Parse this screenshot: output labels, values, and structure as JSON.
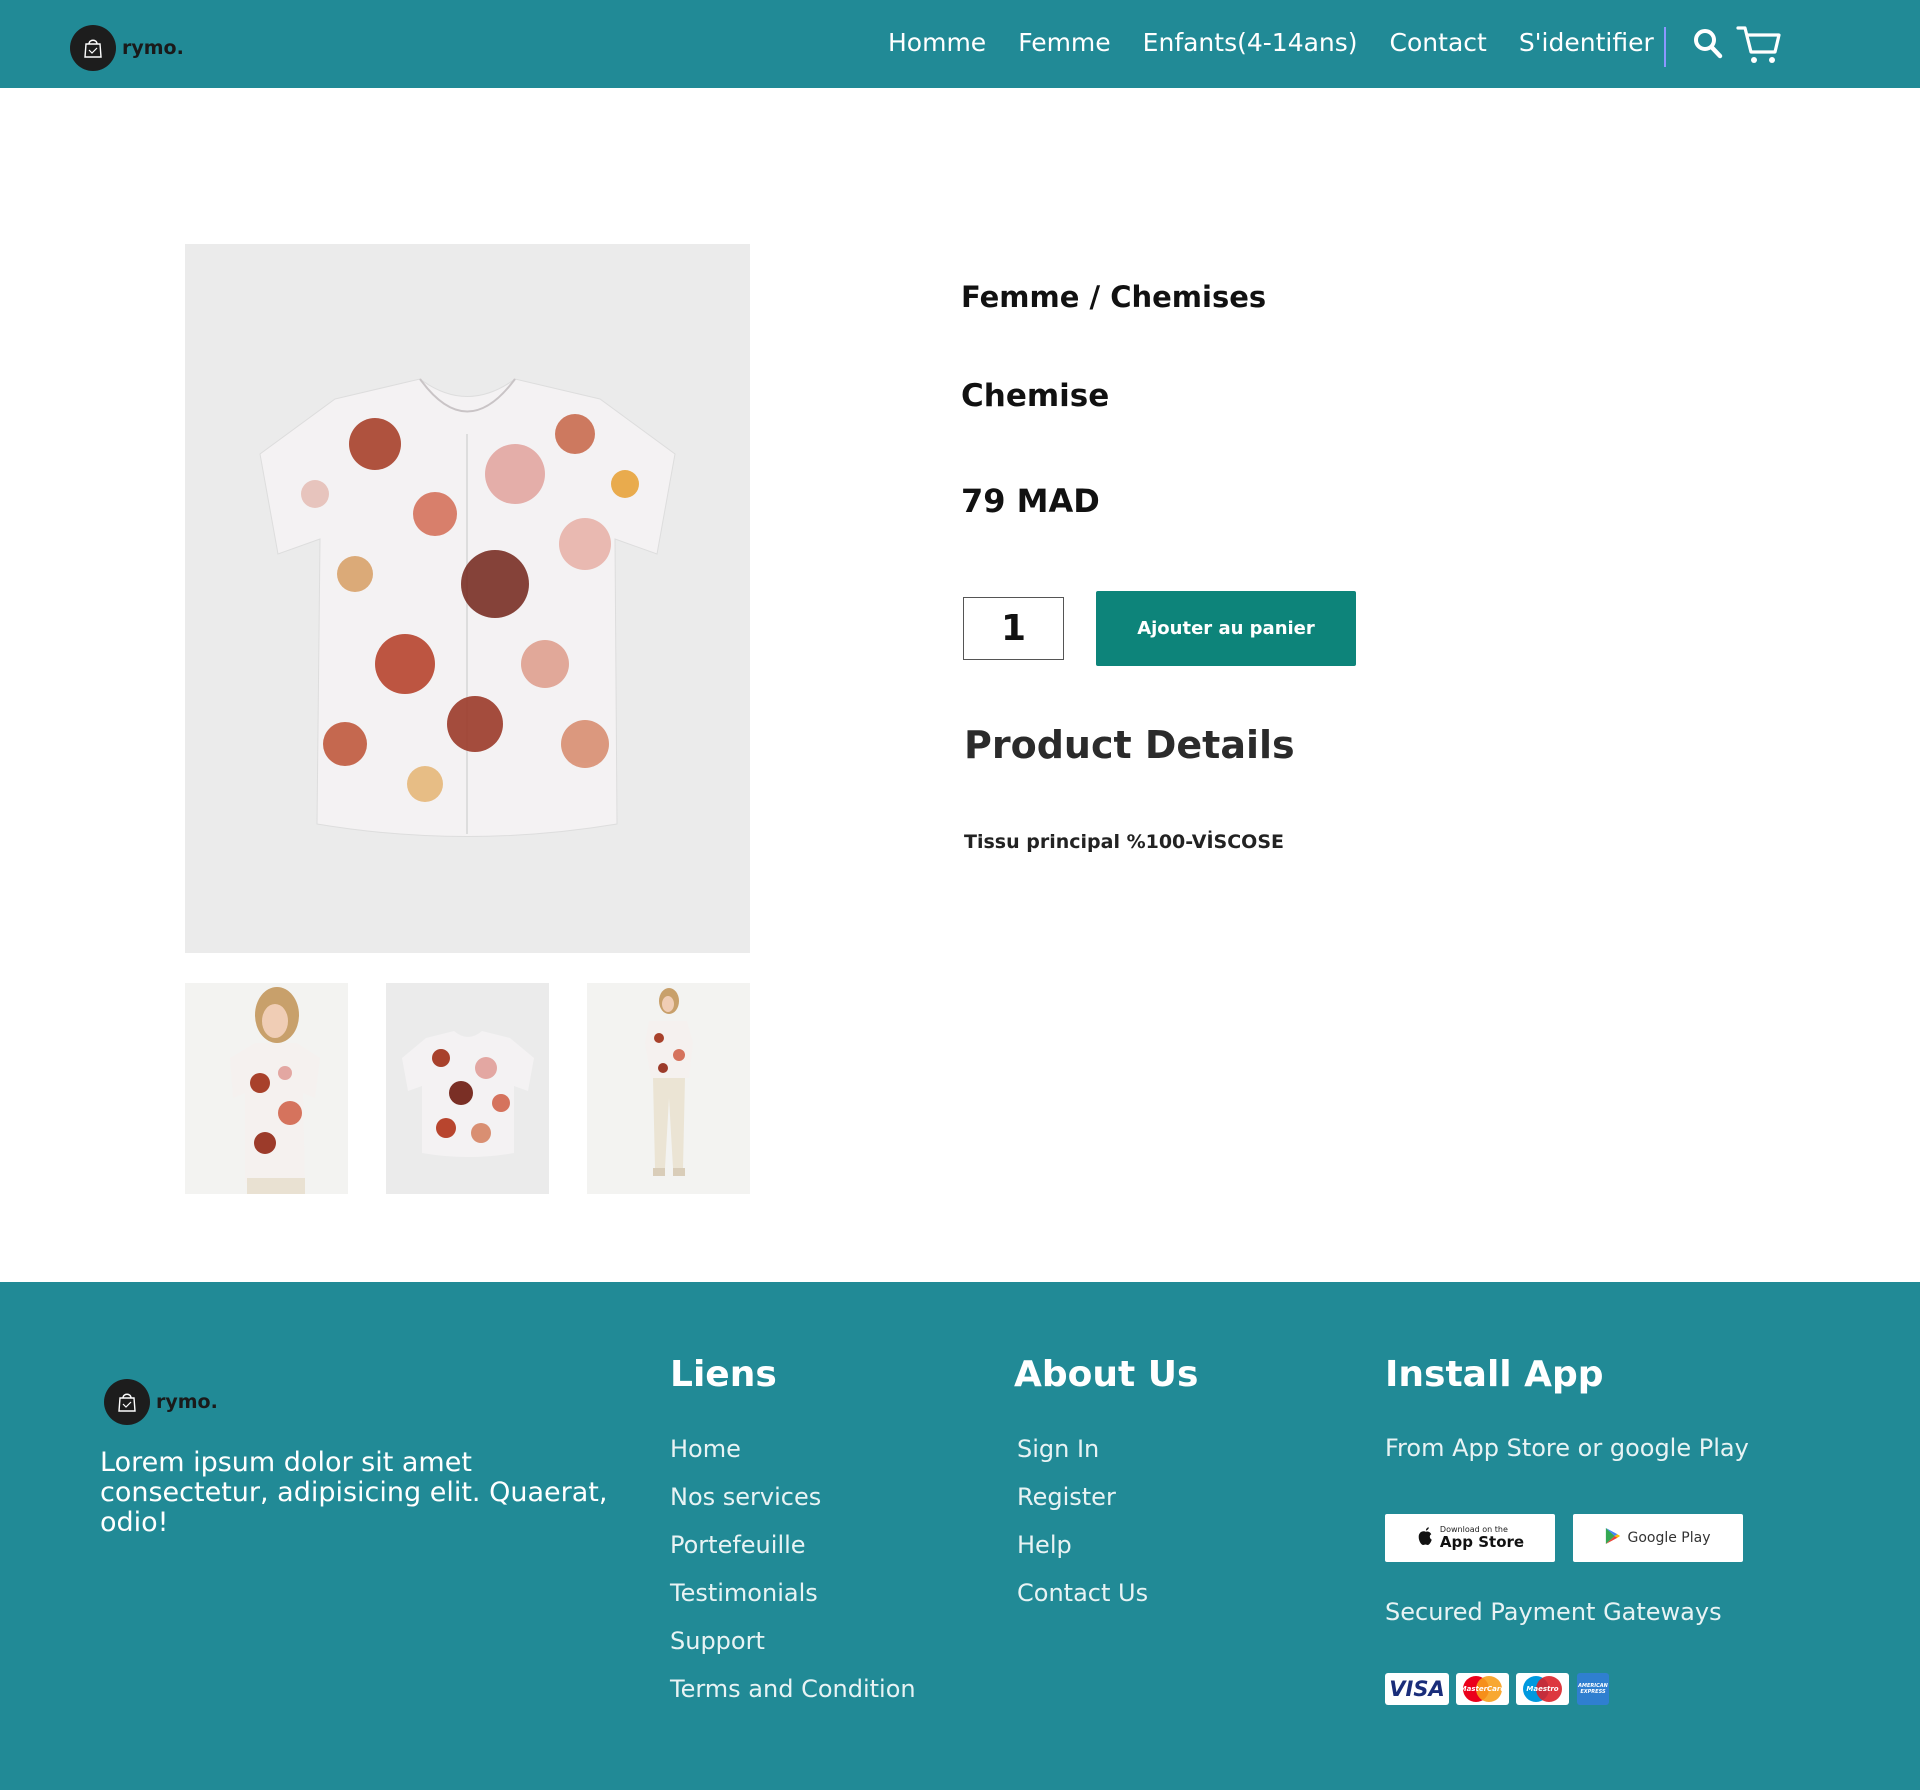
{
  "nav": {
    "brand": "rymo.",
    "links": [
      "Homme",
      "Femme",
      "Enfants(4-14ans)",
      "Contact",
      "S'identifier"
    ],
    "icons": [
      "search-icon",
      "cart-icon"
    ]
  },
  "product": {
    "breadcrumb": "Femme / Chemises",
    "name": "Chemise",
    "price": "79 MAD",
    "quantity": "1",
    "add_to_cart_label": "Ajouter au panier",
    "details_title": "Product Details",
    "details_text": "Tissu principal %100-VİSCOSE"
  },
  "footer": {
    "brand": "rymo.",
    "description": "Lorem ipsum dolor sit amet consectetur, adipisicing elit. Quaerat, odio!",
    "liens": {
      "title": "Liens",
      "items": [
        "Home",
        "Nos services",
        "Portefeuille",
        "Testimonials",
        "Support",
        "Terms and Condition"
      ]
    },
    "about": {
      "title": "About Us",
      "items": [
        "Sign In",
        "Register",
        "Help",
        "Contact Us"
      ]
    },
    "install": {
      "title": "Install App",
      "subtitle": "From App Store or google Play",
      "app_store_small": "Download on the",
      "app_store_big": "App Store",
      "google_play": "Google Play",
      "secured": "Secured Payment Gateways",
      "visa": "VISA",
      "mastercard": "MasterCard",
      "maestro": "Maestro",
      "amex": "AMERICAN EXPRESS"
    }
  },
  "colors": {
    "brand_teal": "#218a96",
    "button_green": "#0d847a",
    "nav_divider": "#8d97ff"
  }
}
